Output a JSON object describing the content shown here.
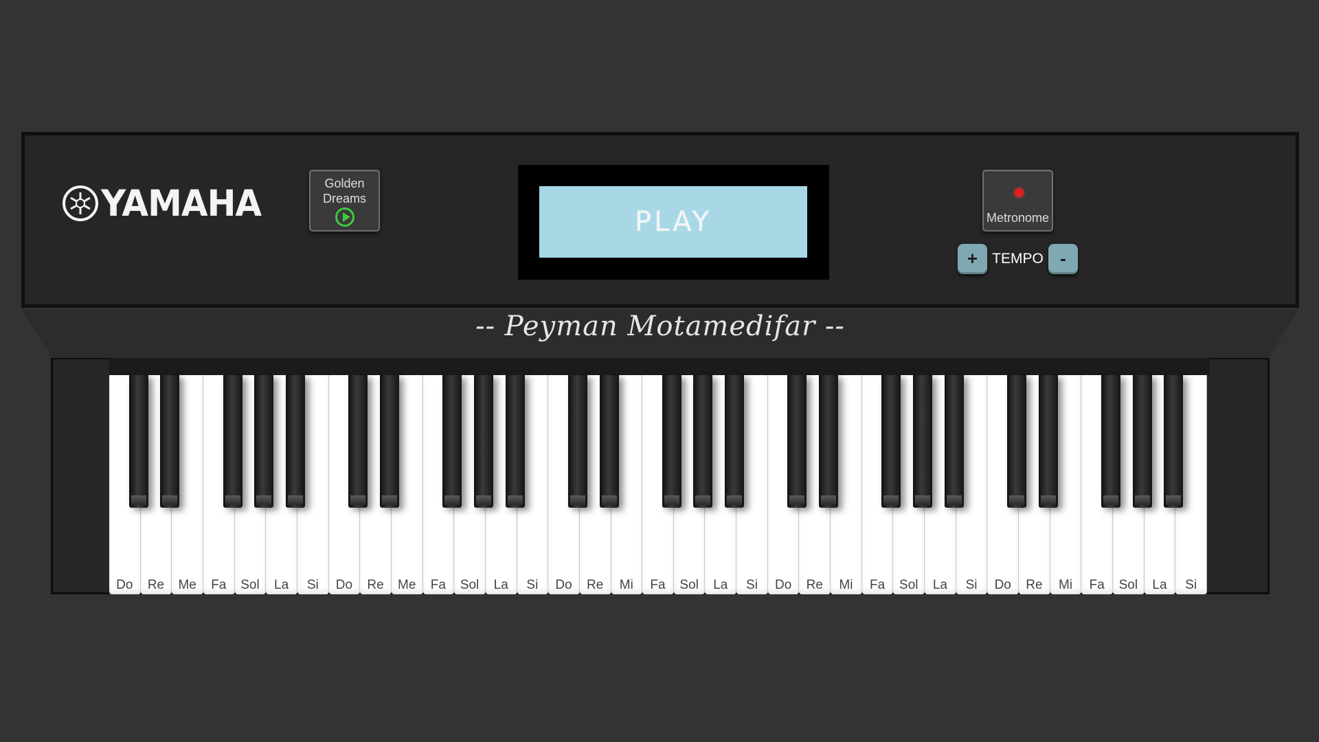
{
  "brand": {
    "name": "YAMAHA"
  },
  "song_button": {
    "line1": "Golden",
    "line2": "Dreams",
    "icon": "play-circle-icon"
  },
  "display": {
    "text": "PLAY",
    "background": "#a8d8e6"
  },
  "metronome": {
    "label": "Metronome",
    "indicator_color": "#e02020"
  },
  "tempo": {
    "increase_label": "+",
    "label": "TEMPO",
    "decrease_label": "-"
  },
  "signature": "-- Peyman Motamedifar --",
  "piano": {
    "white_keys": [
      "Do",
      "Re",
      "Me",
      "Fa",
      "Sol",
      "La",
      "Si",
      "Do",
      "Re",
      "Me",
      "Fa",
      "Sol",
      "La",
      "Si",
      "Do",
      "Re",
      "Mi",
      "Fa",
      "Sol",
      "La",
      "Si",
      "Do",
      "Re",
      "Mi",
      "Fa",
      "Sol",
      "La",
      "Si",
      "Do",
      "Re",
      "Mi",
      "Fa",
      "Sol",
      "La",
      "Si"
    ],
    "octaves": 5
  }
}
